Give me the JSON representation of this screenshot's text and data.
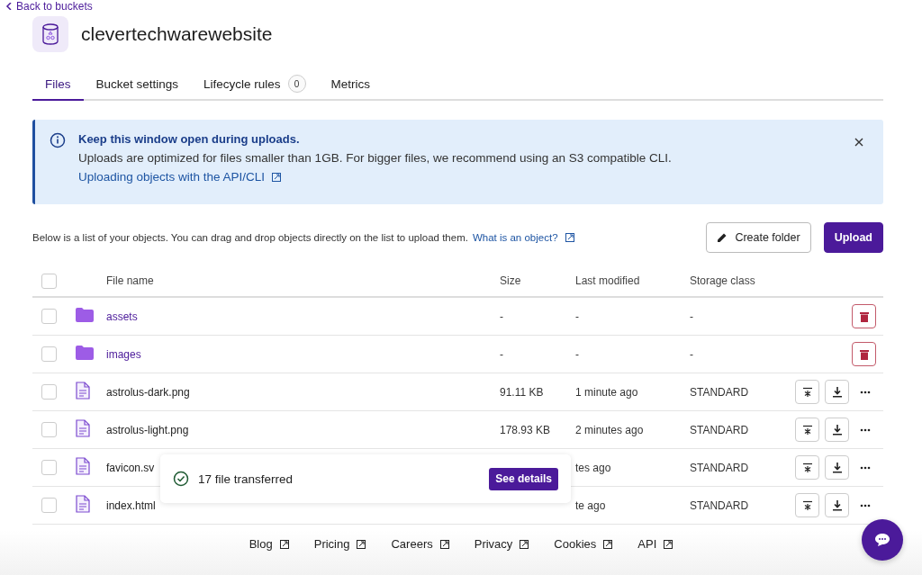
{
  "back_link": "Back to buckets",
  "bucket": {
    "name": "clevertechwarewebsite"
  },
  "tabs": [
    {
      "label": "Files",
      "selected": true
    },
    {
      "label": "Bucket settings",
      "selected": false
    },
    {
      "label": "Lifecycle rules",
      "badge": "0",
      "selected": false
    },
    {
      "label": "Metrics",
      "selected": false
    }
  ],
  "alert": {
    "title": "Keep this window open during uploads.",
    "message": "Uploads are optimized for files smaller than 1GB. For bigger files, we recommend using an S3 compatible CLI.",
    "link": "Uploading objects with the API/CLI"
  },
  "intro": {
    "text": "Below is a list of your objects. You can drag and drop objects directly on the list to upload them.",
    "link": "What is an object?"
  },
  "buttons": [
    {
      "kind": "secondary",
      "label": "Create folder"
    },
    {
      "kind": "primary",
      "label": "Upload"
    }
  ],
  "table": {
    "select_all_checked": false,
    "columns": [
      "File name",
      "Size",
      "Last modified",
      "Storage class"
    ],
    "rows": [
      {
        "kind": "folder",
        "checked": false,
        "name": "assets",
        "size": "-",
        "modified": "-",
        "storage": "-"
      },
      {
        "kind": "folder",
        "checked": false,
        "name": "images",
        "size": "-",
        "modified": "-",
        "storage": "-"
      },
      {
        "kind": "file",
        "checked": false,
        "name": "astrolus-dark.png",
        "size": "91.11 KB",
        "modified": "1 minute ago",
        "storage": "STANDARD"
      },
      {
        "kind": "file",
        "checked": false,
        "name": "astrolus-light.png",
        "size": "178.93 KB",
        "modified": "2 minutes ago",
        "storage": "STANDARD"
      },
      {
        "kind": "file",
        "checked": false,
        "name": "favicon.sv",
        "modified": "tes ago",
        "storage": "STANDARD"
      },
      {
        "kind": "file",
        "checked": false,
        "name": "index.html",
        "modified": "te ago",
        "storage": "STANDARD"
      }
    ]
  },
  "toast": {
    "message": "17 file transferred",
    "button": "See details"
  },
  "footer": {
    "links": [
      "Blog",
      "Pricing",
      "Careers",
      "Privacy",
      "Cookies",
      "API"
    ]
  }
}
